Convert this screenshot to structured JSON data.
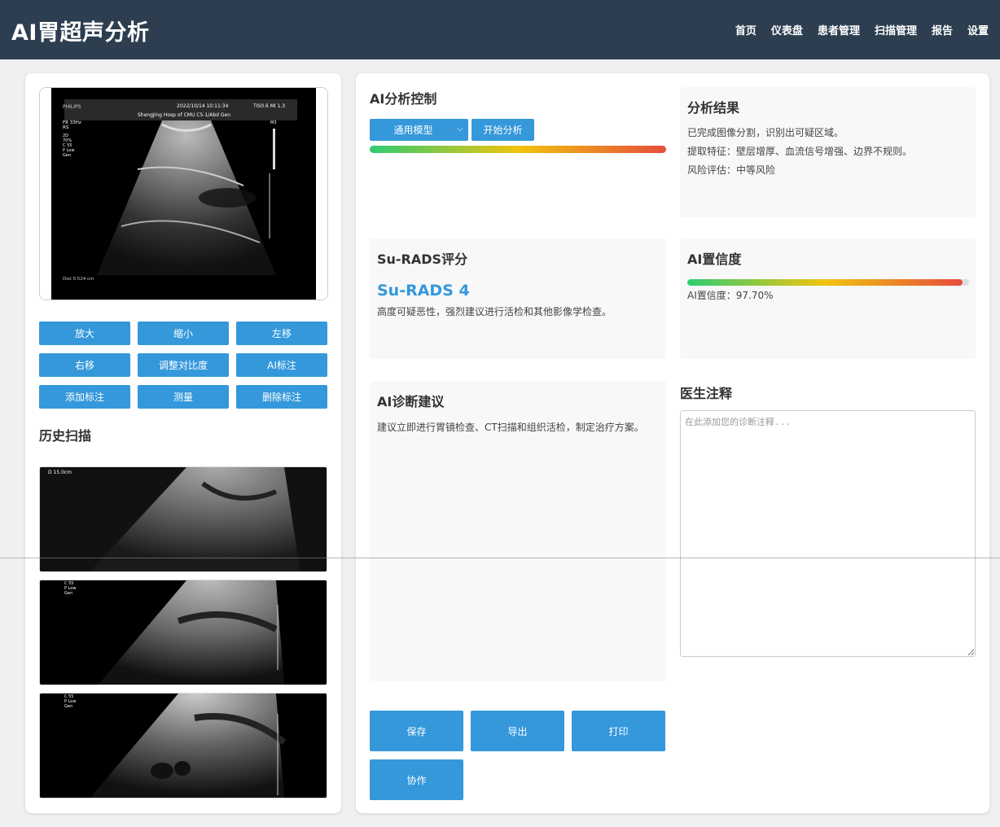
{
  "header": {
    "title": "AI胃超声分析",
    "nav": [
      "首页",
      "仪表盘",
      "患者管理",
      "扫描管理",
      "报告",
      "设置"
    ]
  },
  "viewer": {
    "brand": "PHILIPS",
    "datetime": "2022/10/14   10:11:34",
    "ti_mi": "TIS0.6   MI 1.3",
    "hospital": "ShengJing Hosp of CMU   C5-1/Abd Gen",
    "fr": "FR 33Hz",
    "rs": "RS",
    "params": [
      "2D",
      "70%",
      "C 55",
      "P Low",
      "Gen"
    ],
    "m3": "M3",
    "dist": "Dist  0.524 cm"
  },
  "tools": [
    "放大",
    "缩小",
    "左移",
    "右移",
    "调整对比度",
    "AI标注",
    "添加标注",
    "测量",
    "删除标注"
  ],
  "history": {
    "title": "历史扫描",
    "thumb1_label": "D     15.0cm",
    "thumb2_params": [
      "C 55",
      "P Low",
      "Gen"
    ],
    "thumb3_params": [
      "C 55",
      "P Low",
      "Gen"
    ]
  },
  "analysis_control": {
    "title": "AI分析控制",
    "model_select": "通用模型",
    "start_button": "开始分析"
  },
  "results": {
    "title": "分析结果",
    "lines": [
      "已完成图像分割，识别出可疑区域。",
      "提取特征：壁层增厚、血流信号增强、边界不规则。",
      "风险评估：中等风险"
    ]
  },
  "surads": {
    "title": "Su-RADS评分",
    "value": "Su-RADS 4",
    "description": "高度可疑恶性，强烈建议进行活检和其他影像学检查。"
  },
  "confidence": {
    "title": "AI置信度",
    "label": "AI置信度：97.70%",
    "value_fraction": 0.977
  },
  "diagnosis": {
    "title": "AI诊断建议",
    "text": "建议立即进行胃镜检查、CT扫描和组织活检，制定治疗方案。"
  },
  "notes": {
    "title": "医生注释",
    "placeholder": "在此添加您的诊断注释..."
  },
  "actions": [
    "保存",
    "导出",
    "打印",
    "协作"
  ],
  "colors": {
    "header_bg": "#2c3e50",
    "accent": "#3498db",
    "page_bg": "#eef0f2"
  }
}
